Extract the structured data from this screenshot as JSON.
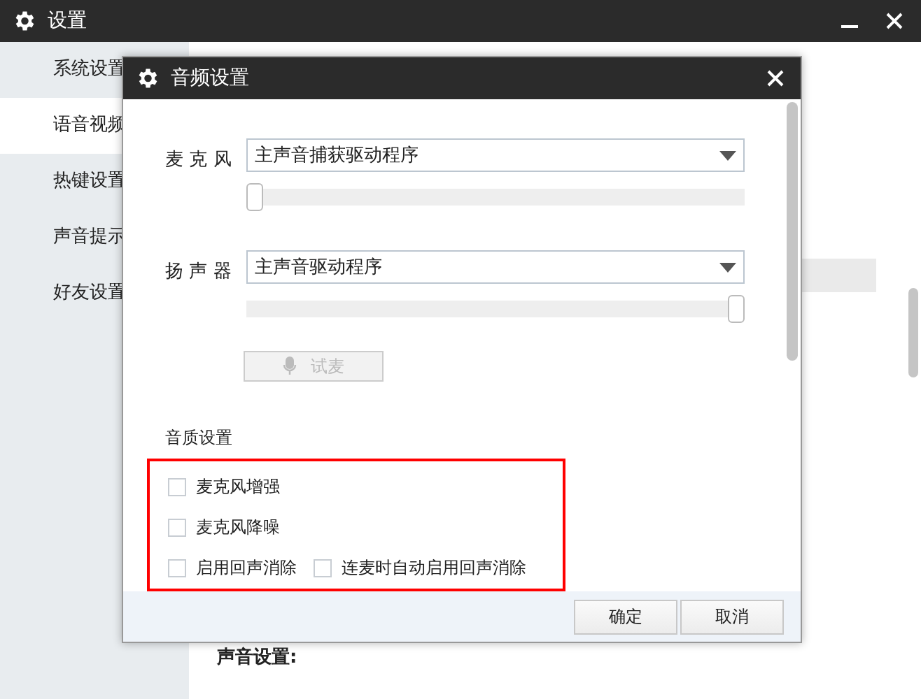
{
  "window": {
    "title": "设置"
  },
  "sidebar": {
    "items": [
      {
        "label": "系统设置",
        "selected": false
      },
      {
        "label": "语音视频",
        "selected": true
      },
      {
        "label": "热键设置",
        "selected": false
      },
      {
        "label": "声音提示",
        "selected": false
      },
      {
        "label": "好友设置",
        "selected": false
      }
    ]
  },
  "main": {
    "section_title": "声音设置:"
  },
  "dialog": {
    "title": "音频设置",
    "devices": [
      {
        "label": "麦 克 风",
        "value": "主声音捕获驱动程序",
        "level": 0
      },
      {
        "label": "扬 声 器",
        "value": "主声音驱动程序",
        "level": 1
      }
    ],
    "test_button": {
      "label": "试麦",
      "disabled": true
    },
    "quality_title": "音质设置",
    "options": [
      [
        {
          "label": "麦克风增强",
          "checked": false
        }
      ],
      [
        {
          "label": "麦克风降噪",
          "checked": false
        }
      ],
      [
        {
          "label": "启用回声消除",
          "checked": false
        },
        {
          "label": "连麦时自动启用回声消除",
          "checked": false
        }
      ]
    ],
    "buttons": [
      "确定",
      "取消"
    ]
  }
}
